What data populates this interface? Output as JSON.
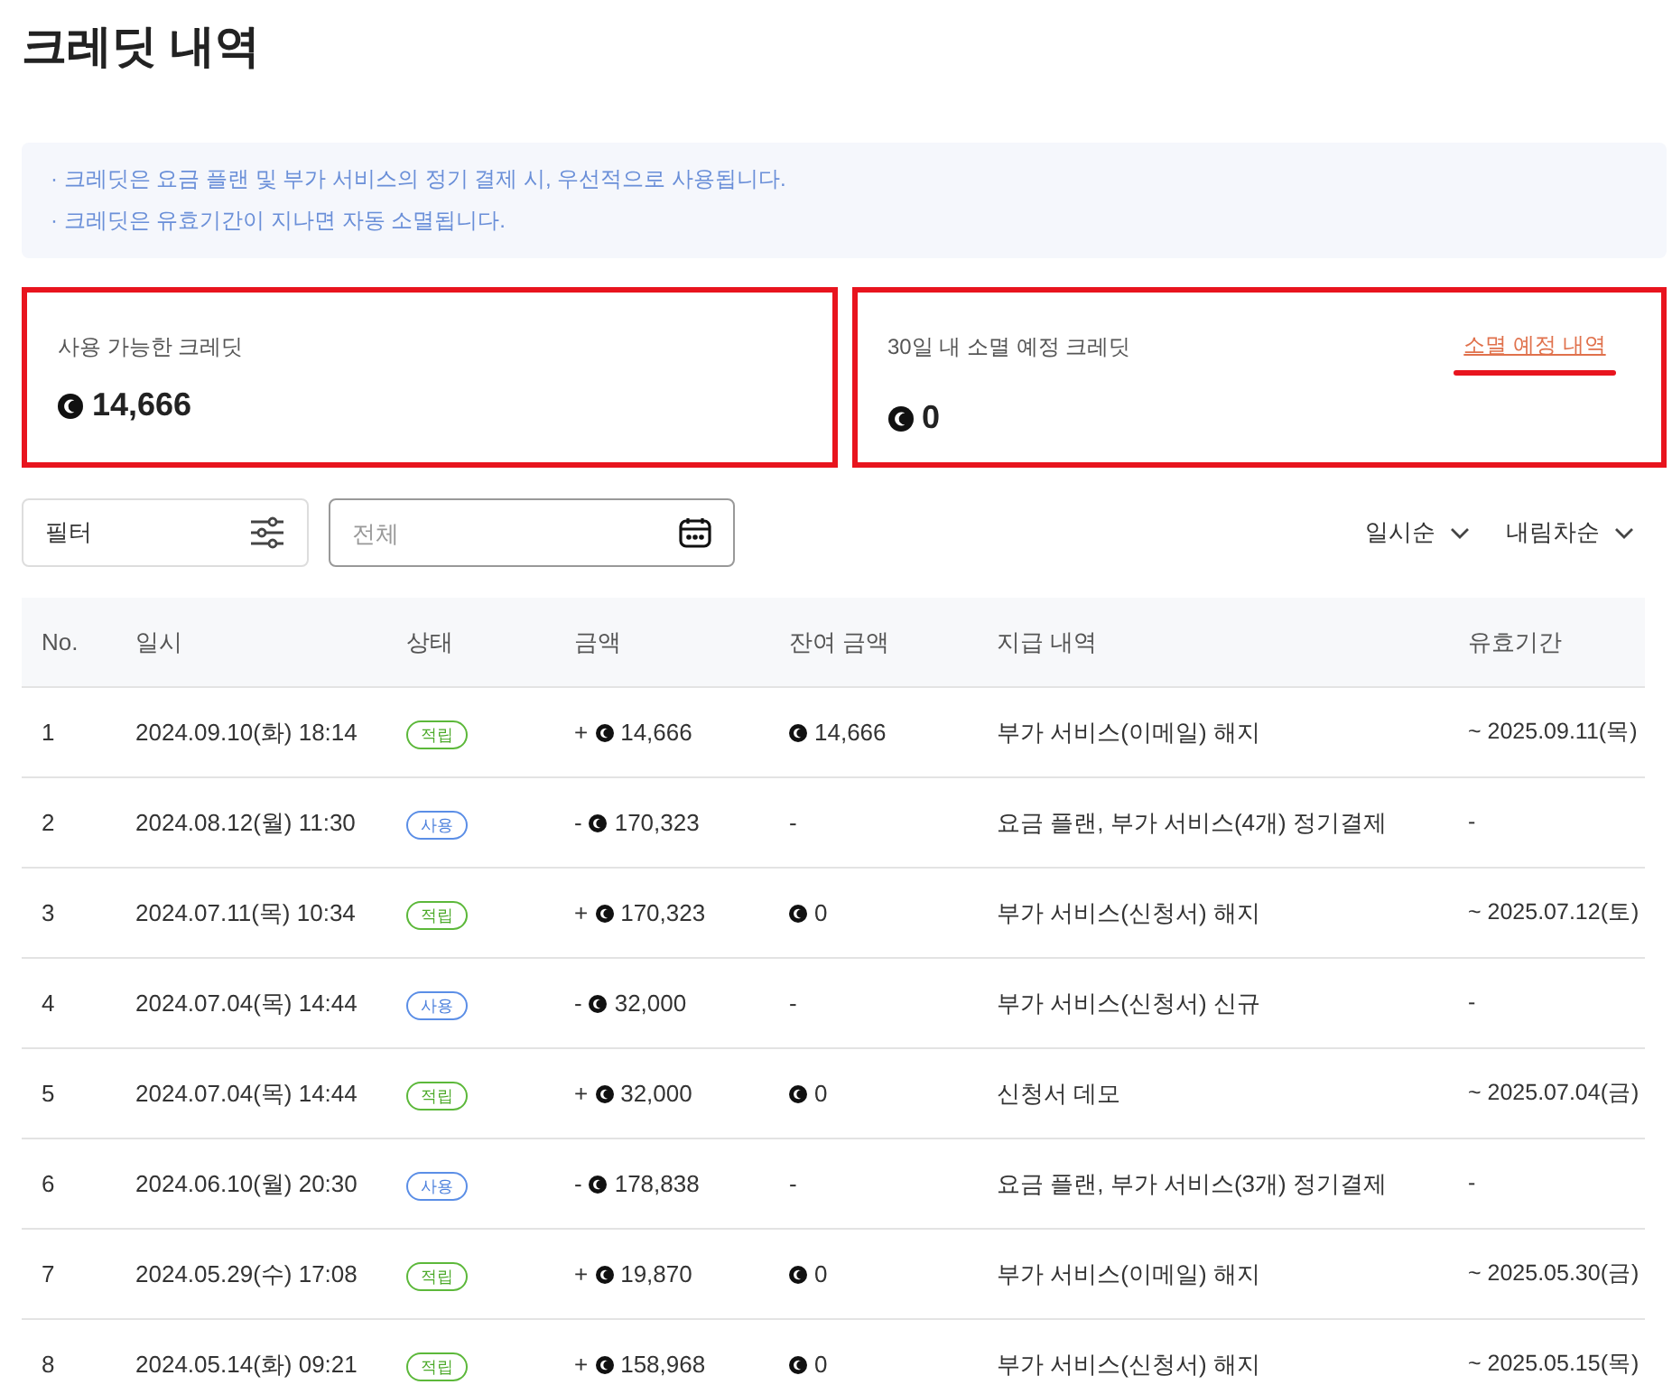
{
  "title": "크레딧 내역",
  "notices": [
    "· 크레딧은 요금 플랜 및 부가 서비스의 정기 결제 시, 우선적으로 사용됩니다.",
    "· 크레딧은 유효기간이 지나면 자동 소멸됩니다."
  ],
  "summary": [
    {
      "label": "사용 가능한 크레딧",
      "value": "14,666"
    },
    {
      "label": "30일 내 소멸 예정 크레딧",
      "value": "0",
      "link": "소멸 예정 내역"
    }
  ],
  "filter": {
    "label": "필터"
  },
  "date_range": {
    "placeholder": "전체"
  },
  "sorts": [
    "일시순",
    "내림차순"
  ],
  "table": {
    "columns": [
      "No.",
      "일시",
      "상태",
      "금액",
      "잔여 금액",
      "지급 내역",
      "유효기간"
    ],
    "rows": [
      {
        "no": "1",
        "date": "2024.09.10(화) 18:14",
        "status": "적립",
        "kind": "earn",
        "sign": "+",
        "amount": "14,666",
        "balance": "14,666",
        "detail": "부가 서비스(이메일) 해지",
        "expiry": "~ 2025.09.11(목)"
      },
      {
        "no": "2",
        "date": "2024.08.12(월) 11:30",
        "status": "사용",
        "kind": "use",
        "sign": "-",
        "amount": "170,323",
        "balance": "-",
        "detail": "요금 플랜, 부가 서비스(4개) 정기결제",
        "expiry": "-"
      },
      {
        "no": "3",
        "date": "2024.07.11(목) 10:34",
        "status": "적립",
        "kind": "earn",
        "sign": "+",
        "amount": "170,323",
        "balance": "0",
        "detail": "부가 서비스(신청서) 해지",
        "expiry": "~ 2025.07.12(토)"
      },
      {
        "no": "4",
        "date": "2024.07.04(목) 14:44",
        "status": "사용",
        "kind": "use",
        "sign": "-",
        "amount": "32,000",
        "balance": "-",
        "detail": "부가 서비스(신청서) 신규",
        "expiry": "-"
      },
      {
        "no": "5",
        "date": "2024.07.04(목) 14:44",
        "status": "적립",
        "kind": "earn",
        "sign": "+",
        "amount": "32,000",
        "balance": "0",
        "detail": "신청서 데모",
        "expiry": "~ 2025.07.04(금)"
      },
      {
        "no": "6",
        "date": "2024.06.10(월) 20:30",
        "status": "사용",
        "kind": "use",
        "sign": "-",
        "amount": "178,838",
        "balance": "-",
        "detail": "요금 플랜, 부가 서비스(3개) 정기결제",
        "expiry": "-"
      },
      {
        "no": "7",
        "date": "2024.05.29(수) 17:08",
        "status": "적립",
        "kind": "earn",
        "sign": "+",
        "amount": "19,870",
        "balance": "0",
        "detail": "부가 서비스(이메일) 해지",
        "expiry": "~ 2025.05.30(금)"
      },
      {
        "no": "8",
        "date": "2024.05.14(화) 09:21",
        "status": "적립",
        "kind": "earn",
        "sign": "+",
        "amount": "158,968",
        "balance": "0",
        "detail": "부가 서비스(신청서) 해지",
        "expiry": "~ 2025.05.15(목)"
      }
    ]
  }
}
